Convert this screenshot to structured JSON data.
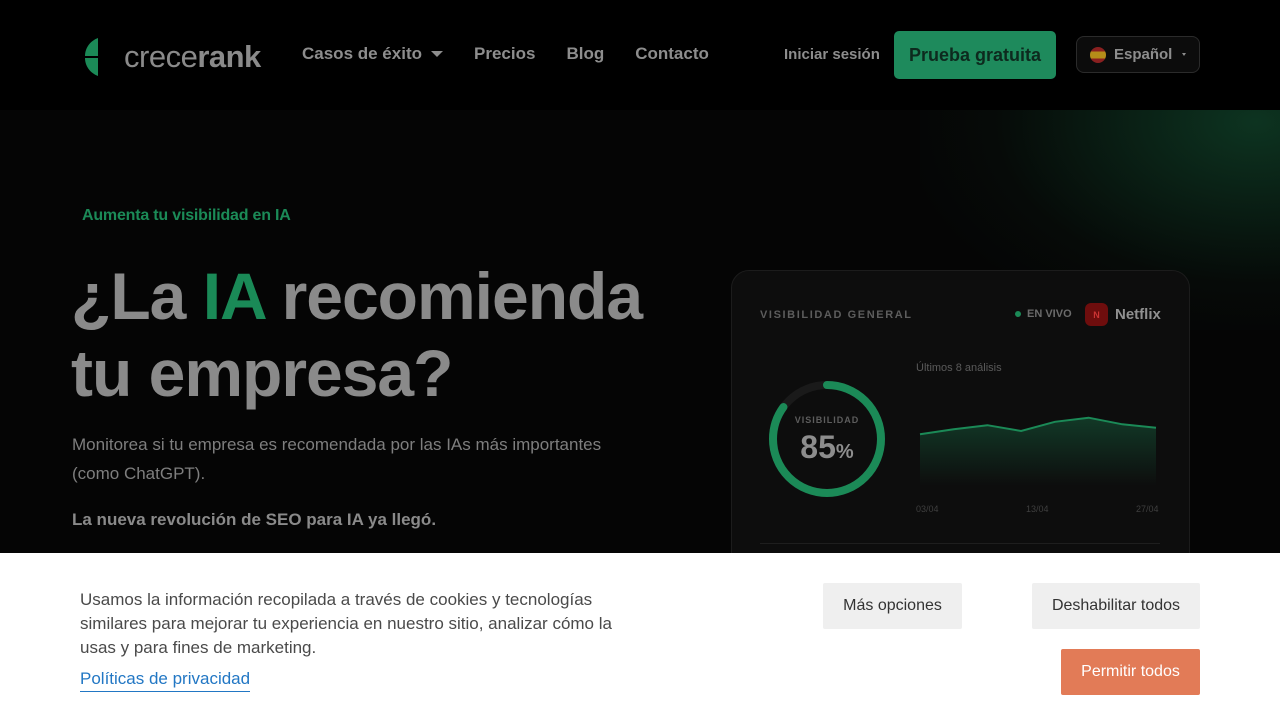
{
  "nav": {
    "logo_light": "crece",
    "logo_bold": "rank",
    "links": [
      {
        "label": "Casos de éxito",
        "has_dropdown": true
      },
      {
        "label": "Precios"
      },
      {
        "label": "Blog"
      },
      {
        "label": "Contacto"
      }
    ],
    "login_label": "Iniciar sesión",
    "cta_label": "Prueba gratuita",
    "language_label": "Español"
  },
  "hero": {
    "eyebrow": "Aumenta tu visibilidad en IA",
    "headline_part1": "¿La ",
    "headline_accent": "IA",
    "headline_part2": " recomienda tu empresa?",
    "subtext": "Monitorea si tu empresa es recomendada por las IAs más importantes (como ChatGPT).",
    "tagline": "La nueva revolución de SEO para IA ya llegó."
  },
  "dashboard": {
    "title": "VISIBILIDAD GENERAL",
    "live_label": "EN VIVO",
    "brand_initial": "N",
    "brand_name": "Netflix",
    "gauge_label": "VISIBILIDAD",
    "gauge_value": "85",
    "gauge_unit": "%",
    "gauge_fraction": 0.85,
    "chart_caption": "Últimos 8 análisis",
    "x_ticks": [
      "03/04",
      "13/04",
      "27/04"
    ],
    "trend_values": [
      62,
      68,
      73,
      66,
      77,
      82,
      74,
      70
    ]
  },
  "cookie": {
    "text": "Usamos la información recopilada a través de cookies y tecnologías similares para mejorar tu experiencia en nuestro sitio, analizar cómo la usas y para fines de marketing.",
    "privacy_link": "Políticas de privacidad",
    "more_options": "Más opciones",
    "disable_all": "Deshabilitar todos",
    "allow_all": "Permitir todos"
  },
  "colors": {
    "accent_green": "#1b8a57",
    "cookie_allow": "#e27b57",
    "link_blue": "#2277c4"
  }
}
